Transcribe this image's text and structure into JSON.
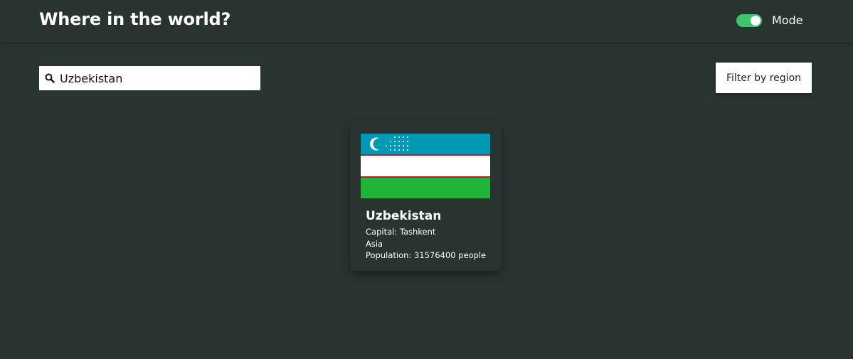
{
  "header": {
    "title": "Where in the world?",
    "mode_label": "Mode",
    "toggle_on": true,
    "toggle_color": "#3ec46d"
  },
  "search": {
    "value": "Uzbekistan",
    "icon": "search-icon"
  },
  "filter": {
    "label": "Filter by region"
  },
  "results": [
    {
      "name": "Uzbekistan",
      "capital_text": "Capital: Tashkent",
      "region": "Asia",
      "population_text": "Population: 31576400 people",
      "flag": {
        "icon": "uzbekistan-flag",
        "colors": [
          "#0099b5",
          "#ce1126",
          "#ffffff",
          "#1eb53a"
        ]
      }
    }
  ],
  "colors": {
    "background": "#2a3533",
    "header": "#29332f",
    "card": "#29332f"
  }
}
